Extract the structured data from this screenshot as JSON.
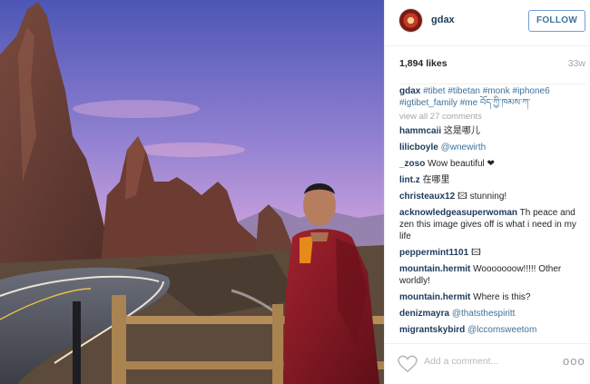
{
  "post": {
    "username": "gdax",
    "follow_label": "FOLLOW",
    "likes": "1,894 likes",
    "age": "33w"
  },
  "caption": {
    "username": "gdax",
    "text": "#tibet #tibetan #monk #iphone6 #igtibet_family #me བོད་ཀྱི་ཁམས་ཀ་"
  },
  "view_all": "view all 27 comments",
  "comments": [
    {
      "user": "hammcaii",
      "text": "这是哪儿"
    },
    {
      "user": "lilicboyle",
      "text": "@wnewirth"
    },
    {
      "user": "_zoso",
      "text": "Wow beautiful ❤"
    },
    {
      "user": "lint.z",
      "text": "在哪里"
    },
    {
      "user": "christeaux12",
      "text": "🖾 stunning!"
    },
    {
      "user": "acknowledgeasuperwoman",
      "text": "Th peace and zen this image gives off is what i need in my life"
    },
    {
      "user": "peppermint1101",
      "text": "🖾"
    },
    {
      "user": "mountain.hermit",
      "text": "Wooooooow!!!!! Other worldly!"
    },
    {
      "user": "mountain.hermit",
      "text": "Where is this?"
    },
    {
      "user": "denizmayra",
      "text": "@thatsthespiritt"
    },
    {
      "user": "migrantskybird",
      "text": "@lccomsweetom"
    }
  ],
  "footer": {
    "add_comment_placeholder": "Add a comment...",
    "more_label": "ooo"
  },
  "colors": {
    "username": "#1d3a5c",
    "link": "#3f729b",
    "muted": "#a5a7aa",
    "sky_top": "#5a5fb8",
    "sky_bottom": "#d7a0d8",
    "robe": "#8b1a24"
  },
  "icons": {
    "heart": "heart-icon",
    "more": "more-options-icon",
    "avatar": "avatar"
  }
}
